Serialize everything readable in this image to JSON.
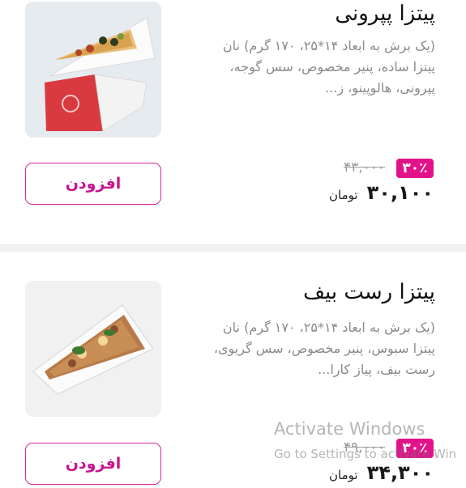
{
  "products": [
    {
      "name": "پیتزا پپرونی",
      "description": "(یک برش به ابعاد ۱۴*۲۵، ۱۷۰ گرم) نان پیتزا ساده، پنیر مخصوص، سس گوجه، پپرونی، هالوپینو، ز...",
      "add_label": "افزودن",
      "discount": "۳۰٪",
      "old_price": "۴۳,۰۰۰",
      "price": "۳۰,۱۰۰",
      "currency": "تومان",
      "image_icon": "pepperoni-pizza-slice"
    },
    {
      "name": "پیتزا رست بیف",
      "description": "(یک برش به ابعاد ۱۴*۲۵، ۱۷۰ گرم) نان پیتزا سبوس، پنیر مخصوص، سس گریوی، رست بیف، پیاز کارا...",
      "add_label": "افزودن",
      "discount": "۳۰٪",
      "old_price": "۴۹,۰۰۰",
      "price": "۳۴,۳۰۰",
      "currency": "تومان",
      "image_icon": "roast-beef-pizza-slice"
    }
  ],
  "colors": {
    "accent": "#d6249f",
    "badge": "#e2138a"
  },
  "watermark": {
    "title": "Activate Windows",
    "subtitle": "Go to Settings to activate Win"
  }
}
